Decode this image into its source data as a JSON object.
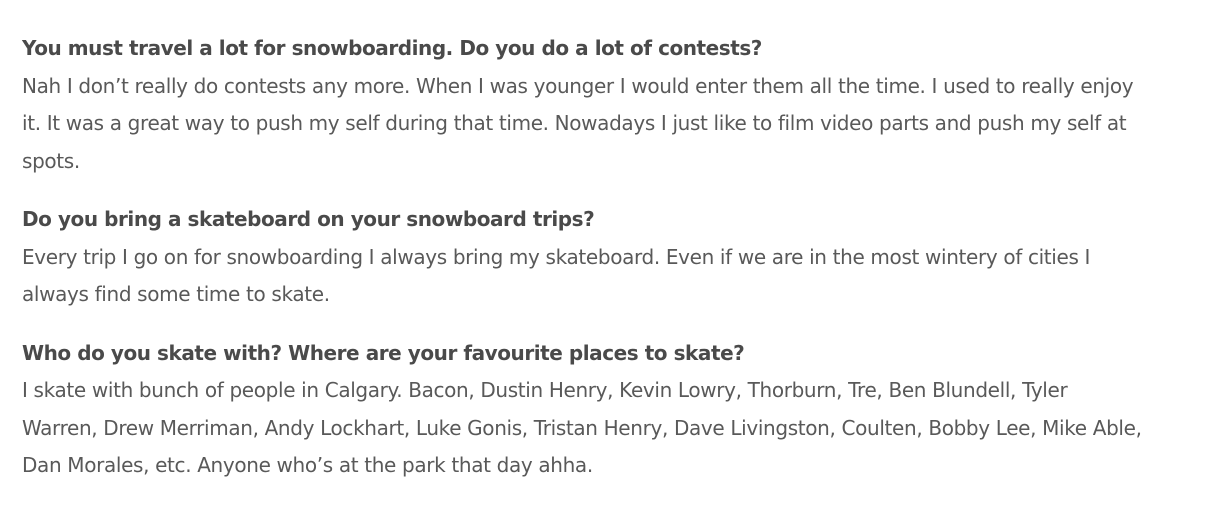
{
  "article": {
    "qa": [
      {
        "question": "You must travel a lot for snowboarding. Do you do a lot of contests?",
        "answer": "Nah I don’t really do contests any more. When I was younger I would enter them all the time. I used to really enjoy it. It was a great way to push my self during that time. Nowadays I just like to film video parts and push my self at spots."
      },
      {
        "question": "Do you bring a skateboard on your snowboard trips?",
        "answer": "Every trip I go on for snowboarding I always bring my skateboard. Even if we are in the most wintery of cities I always find some time to skate."
      },
      {
        "question": "Who do you skate with? Where are your favourite places to skate?",
        "answer": "I skate with bunch of people in Calgary. Bacon, Dustin Henry, Kevin Lowry, Thorburn, Tre, Ben Blundell, Tyler Warren, Drew Merriman, Andy Lockhart, Luke Gonis, Tristan Henry, Dave Livingston, Coulten, Bobby Lee, Mike Able, Dan Morales, etc. Anyone who’s at the park that day ahha."
      }
    ]
  }
}
